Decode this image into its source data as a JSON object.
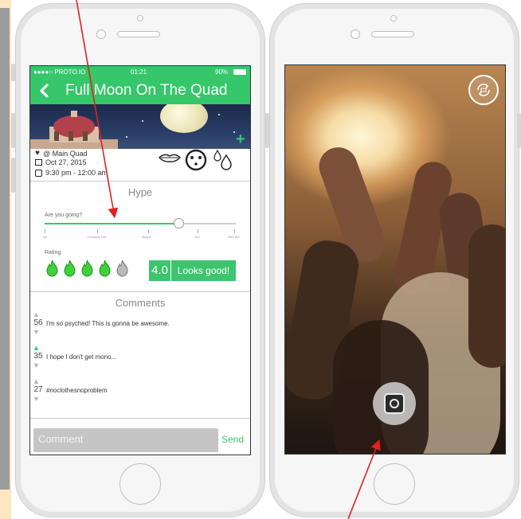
{
  "left_phone": {
    "status": {
      "carrier": "●●●●○ PROTO.IO",
      "time": "01:21",
      "battery": "90%"
    },
    "nav": {
      "back_icon": "chevron-left-icon",
      "title": "Full Moon On The Quad",
      "add_icon": "plus-icon"
    },
    "event": {
      "location": "@ Main Quad",
      "date": "Oct 27, 2015",
      "time_range": "9:30 pm - 12:00 am",
      "category_icons": [
        "lips-icon",
        "face-icon",
        "drops-icon"
      ]
    },
    "hype": {
      "title": "Hype",
      "question": "Are you going?",
      "slider_level": 0.7,
      "ticks": [
        "No",
        "Probably Not",
        "Maybe",
        "Yes",
        "Hell Yes"
      ]
    },
    "rating": {
      "label": "Rating",
      "flames_filled": 4,
      "flames_total": 5,
      "score": "4.0",
      "verdict": "Looks good!"
    },
    "comments": {
      "title": "Comments",
      "items": [
        {
          "votes": "56",
          "text": "I'm so psyched! This is gonna be awesome.",
          "upvoted": false
        },
        {
          "votes": "35",
          "text": "I hope I don't get mono...",
          "upvoted": true
        },
        {
          "votes": "27",
          "text": "#noclothesnoproblem",
          "upvoted": false
        }
      ]
    },
    "composer": {
      "placeholder": "Comment",
      "send_label": "Send"
    }
  },
  "right_phone": {
    "switch_camera_icon": "switch-camera-icon",
    "shutter_icon": "camera-shutter-icon"
  },
  "colors": {
    "accent": "#35c76a",
    "annotation_arrow": "#e02020"
  }
}
